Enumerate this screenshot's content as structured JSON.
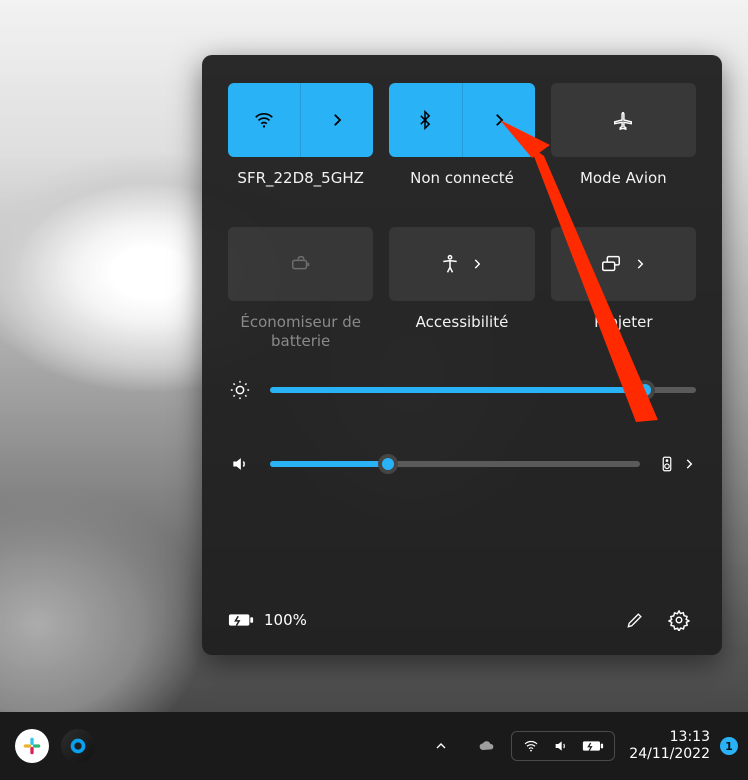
{
  "colors": {
    "accent": "#29b2f6"
  },
  "tiles": {
    "wifi": {
      "label": "SFR_22D8_5GHZ",
      "on": true,
      "hasExpand": true
    },
    "bluetooth": {
      "label": "Non connecté",
      "on": true,
      "hasExpand": true
    },
    "airplane": {
      "label": "Mode Avion",
      "on": false,
      "hasExpand": false
    },
    "battery": {
      "label": "Économiseur de batterie",
      "on": false,
      "hasExpand": false,
      "disabled": true
    },
    "accessibility": {
      "label": "Accessibilité",
      "on": false,
      "hasExpand": true
    },
    "project": {
      "label": "Projeter",
      "on": false,
      "hasExpand": true
    }
  },
  "sliders": {
    "brightness": {
      "percent": 88
    },
    "volume": {
      "percent": 32
    }
  },
  "footer": {
    "battery_text": "100%"
  },
  "taskbar": {
    "time": "13:13",
    "date": "24/11/2022",
    "notif_count": "1"
  }
}
